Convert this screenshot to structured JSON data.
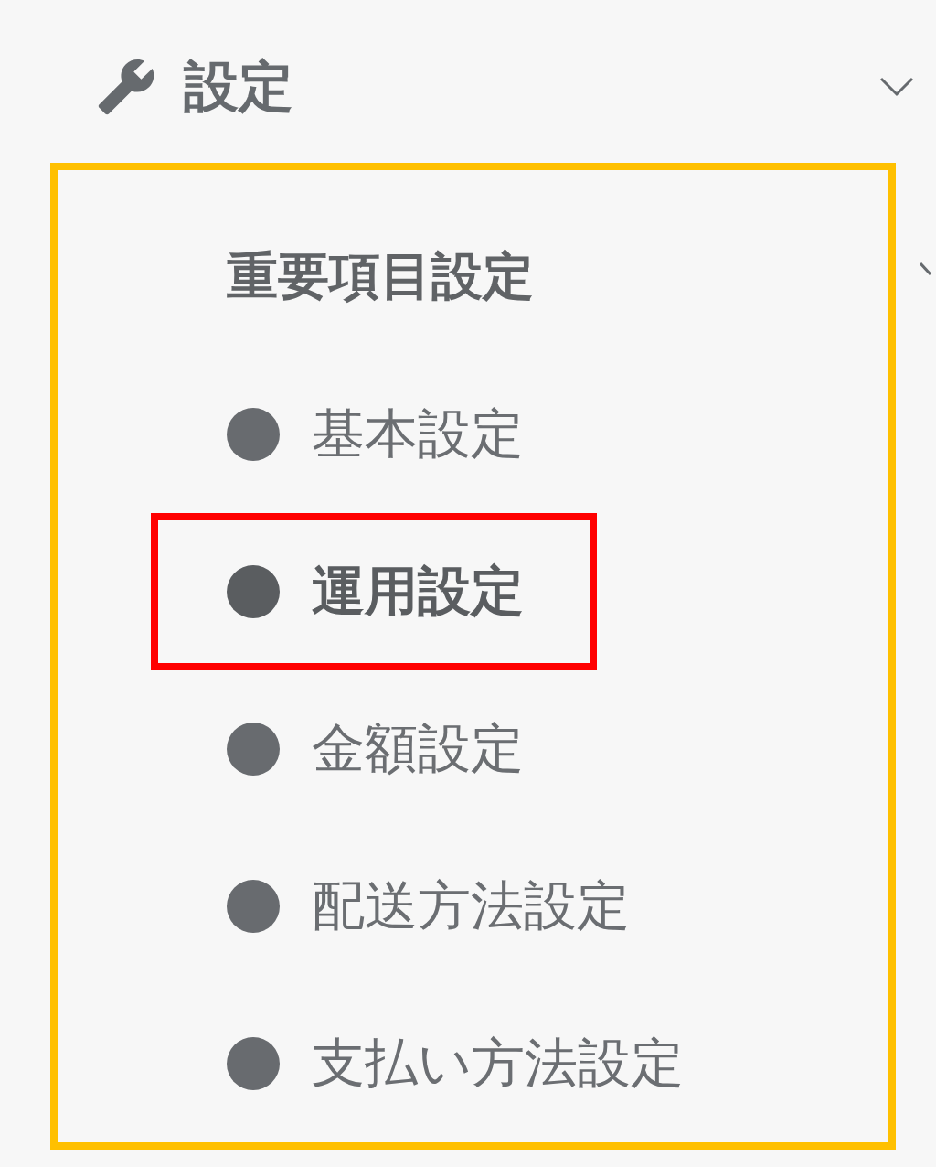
{
  "header": {
    "title": "設定"
  },
  "group": {
    "title": "重要項目設定",
    "items": [
      {
        "label": "基本設定",
        "selected": false
      },
      {
        "label": "運用設定",
        "selected": true
      },
      {
        "label": "金額設定",
        "selected": false
      },
      {
        "label": "配送方法設定",
        "selected": false
      },
      {
        "label": "支払い方法設定",
        "selected": false
      }
    ]
  }
}
